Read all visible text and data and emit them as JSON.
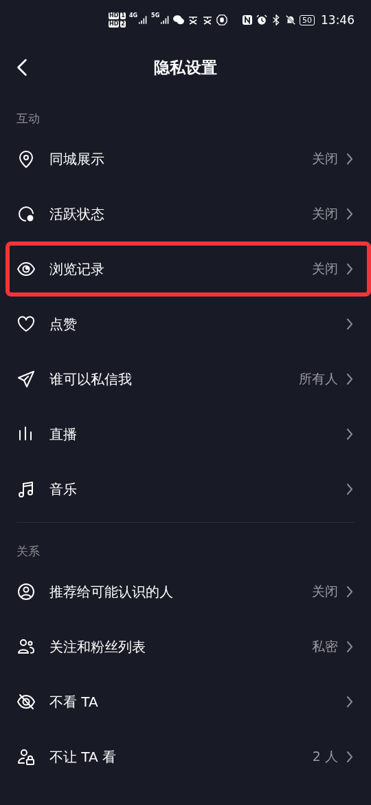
{
  "status_bar": {
    "sim_labels": [
      "HD",
      "1",
      "HD",
      "2"
    ],
    "network_labels": [
      "4G",
      "5G"
    ],
    "battery": "50",
    "time": "13:46"
  },
  "header": {
    "title": "隐私设置"
  },
  "sections": [
    {
      "title": "互动",
      "items": [
        {
          "kind": "pin",
          "label": "同城展示",
          "value": "关闭",
          "highlighted": false
        },
        {
          "kind": "status",
          "label": "活跃状态",
          "value": "关闭",
          "highlighted": false
        },
        {
          "kind": "eye",
          "label": "浏览记录",
          "value": "关闭",
          "highlighted": true
        },
        {
          "kind": "heart",
          "label": "点赞",
          "highlighted": false
        },
        {
          "kind": "send",
          "label": "谁可以私信我",
          "value": "所有人",
          "highlighted": false
        },
        {
          "kind": "bars",
          "label": "直播",
          "highlighted": false
        },
        {
          "kind": "music",
          "label": "音乐",
          "highlighted": false
        }
      ]
    },
    {
      "title": "关系",
      "items": [
        {
          "kind": "person-circle",
          "label": "推荐给可能认识的人",
          "value": "关闭",
          "highlighted": false
        },
        {
          "kind": "people",
          "label": "关注和粉丝列表",
          "value": "私密",
          "highlighted": false
        },
        {
          "kind": "eye-off",
          "label": "不看 TA",
          "highlighted": false
        },
        {
          "kind": "person-lock",
          "label": "不让 TA 看",
          "value": "2 人",
          "highlighted": false
        }
      ]
    }
  ]
}
